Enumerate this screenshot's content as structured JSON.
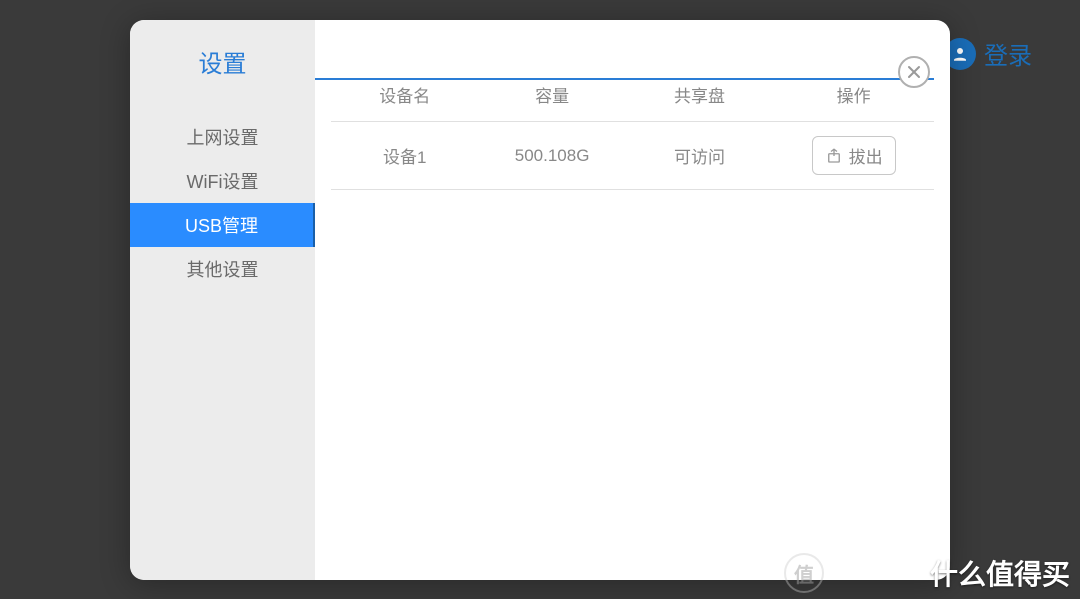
{
  "background": {
    "login_label": "登录"
  },
  "dialog": {
    "title": "设置",
    "sidebar": {
      "items": [
        {
          "label": "上网设置",
          "active": false
        },
        {
          "label": "WiFi设置",
          "active": false
        },
        {
          "label": "USB管理",
          "active": true
        },
        {
          "label": "其他设置",
          "active": false
        }
      ]
    },
    "table": {
      "headers": {
        "device_name": "设备名",
        "capacity": "容量",
        "share_disk": "共享盘",
        "action": "操作"
      },
      "rows": [
        {
          "device_name": "设备1",
          "capacity": "500.108G",
          "share_status": "可访问",
          "action_label": "拔出"
        }
      ]
    }
  },
  "watermark": {
    "badge": "值",
    "text": "什么值得买"
  }
}
